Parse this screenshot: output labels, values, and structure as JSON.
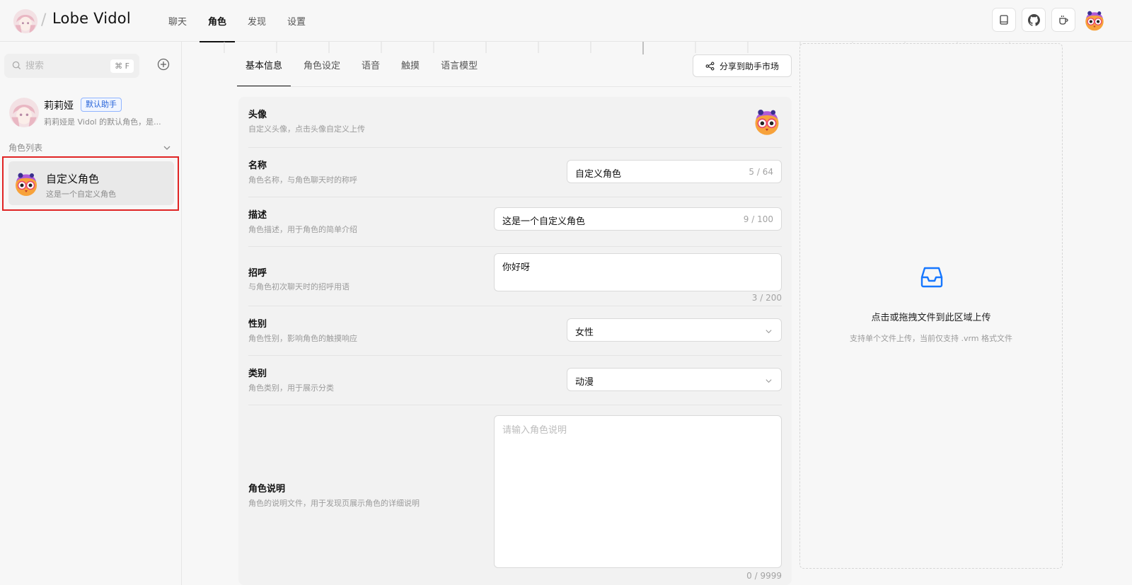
{
  "app": {
    "name": "Lobe Vidol"
  },
  "nav": {
    "items": [
      "聊天",
      "角色",
      "发现",
      "设置"
    ],
    "active_index": 1
  },
  "header_actions": [
    "book-icon",
    "github-icon",
    "coffee-icon",
    "user-avatar"
  ],
  "sidebar": {
    "search_placeholder": "搜索",
    "search_shortcut": "⌘ F",
    "assistant": {
      "name": "莉莉娅",
      "badge": "默认助手",
      "description": "莉莉娅是 Vidol 的默认角色，是..."
    },
    "list_title": "角色列表",
    "roles": [
      {
        "name": "自定义角色",
        "description": "这是一个自定义角色",
        "selected": true
      }
    ]
  },
  "tabs": {
    "items": [
      "基本信息",
      "角色设定",
      "语音",
      "触摸",
      "语言模型"
    ],
    "active_index": 0
  },
  "share_button": "分享到助手市场",
  "form": {
    "avatar": {
      "title": "头像",
      "desc": "自定义头像，点击头像自定义上传"
    },
    "name": {
      "title": "名称",
      "desc": "角色名称，与角色聊天时的称呼",
      "value": "自定义角色",
      "count": "5 / 64"
    },
    "description": {
      "title": "描述",
      "desc": "角色描述，用于角色的简单介绍",
      "value": "这是一个自定义角色",
      "count": "9 / 100"
    },
    "greeting": {
      "title": "招呼",
      "desc": "与角色初次聊天时的招呼用语",
      "value": "你好呀",
      "count": "3 / 200"
    },
    "gender": {
      "title": "性别",
      "desc": "角色性别，影响角色的触摸响应",
      "value": "女性"
    },
    "category": {
      "title": "类别",
      "desc": "角色类别，用于展示分类",
      "value": "动漫"
    },
    "readme": {
      "title": "角色说明",
      "desc": "角色的说明文件，用于发现页展示角色的详细说明",
      "placeholder": "请输入角色说明",
      "count": "0 / 9999"
    }
  },
  "upload": {
    "title": "点击或拖拽文件到此区域上传",
    "hint": "支持单个文件上传，当前仅支持 .vrm 格式文件"
  },
  "colors": {
    "accent": "#1677ff",
    "selection_border": "#e02424",
    "badge_text": "#2563d9"
  }
}
